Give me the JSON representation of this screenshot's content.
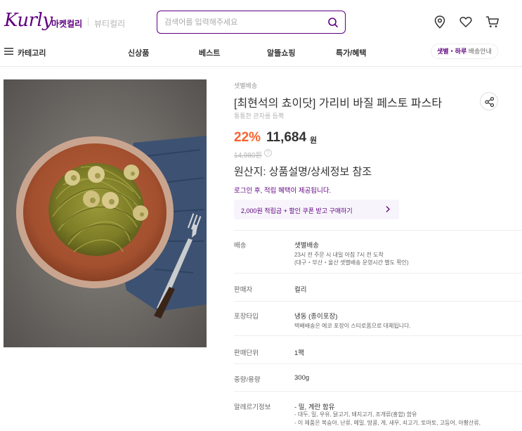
{
  "header": {
    "logo": "Kurly",
    "tab_market": "마켓컬리",
    "tab_beauty": "뷰티컬리",
    "search_placeholder": "검색어를 입력해주세요",
    "icons": [
      "search-icon",
      "location-pin-icon",
      "heart-icon",
      "cart-icon"
    ]
  },
  "nav": {
    "category": "카테고리",
    "items": [
      "신상품",
      "베스트",
      "알뜰쇼핑",
      "특가/혜택"
    ],
    "ship_pill_strong": "샛별・하루",
    "ship_pill_rest": " 배송안내"
  },
  "product": {
    "delivery_tag": "샛별배송",
    "title": "[최현석의 쵸이닷] 가리비 바질 페스토 파스타",
    "subtitle": "통통한 관자를 듬뿍",
    "discount": "22%",
    "price": "11,684",
    "won": "원",
    "original_price": "14,980원",
    "origin": "원산지: 상품설명/상세정보 참조",
    "login_msg": "로그인 후, 적립 혜택이 제공됩니다.",
    "coupon": "2,000원 적립금 + 할인 쿠폰 받고 구매하기"
  },
  "details": [
    {
      "label": "배송",
      "value": "샛별배송",
      "notes": [
        "23시 전 주문 시 내일 아침 7시 전 도착",
        "(대구・부산・울산 샛별배송 운영시간 별도 확인)"
      ]
    },
    {
      "label": "판매자",
      "value": "컬리",
      "notes": []
    },
    {
      "label": "포장타입",
      "value": "냉동 (종이포장)",
      "notes": [
        "택배배송은 에코 포장이 스티로폼으로 대체됩니다."
      ]
    },
    {
      "label": "판매단위",
      "value": "1팩",
      "notes": []
    },
    {
      "label": "중량/용량",
      "value": "300g",
      "notes": []
    },
    {
      "label": "알레르기정보",
      "value": "- 밀, 계란 함유",
      "notes": [
        "- 대두, 밀, 우유, 닭고기, 돼지고기, 조개류(홍합) 함유",
        "- 이 제품은 복숭아, 난류, 메밀, 땅콩, 게, 새우, 쇠고기, 토마토, 고등어, 아황산류,"
      ]
    }
  ],
  "colors": {
    "brand": "#5f0080",
    "discount": "#fa622f"
  }
}
